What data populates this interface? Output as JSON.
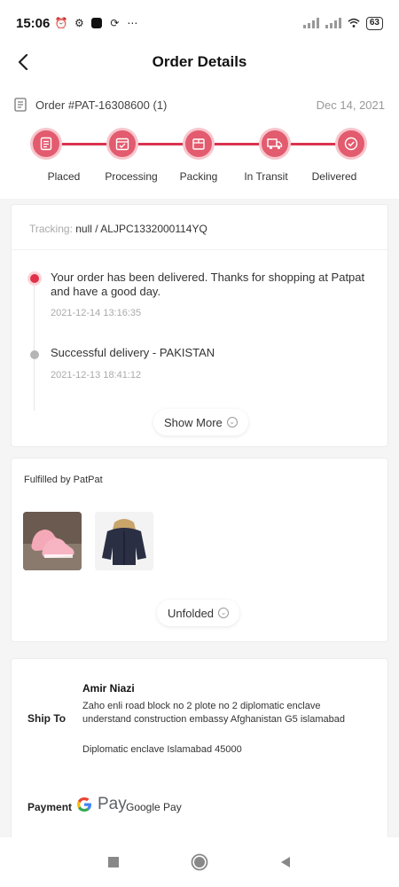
{
  "status_bar": {
    "time": "15:06",
    "battery": "63"
  },
  "header": {
    "title": "Order Details"
  },
  "order": {
    "id": "Order #PAT-16308600 (1)",
    "date": "Dec 14, 2021"
  },
  "steps": [
    {
      "label": "Placed",
      "icon": "receipt-icon"
    },
    {
      "label": "Processing",
      "icon": "calendar-check-icon"
    },
    {
      "label": "Packing",
      "icon": "package-icon"
    },
    {
      "label": "In Transit",
      "icon": "truck-icon"
    },
    {
      "label": "Delivered",
      "icon": "check-circle-icon"
    }
  ],
  "tracking": {
    "label": "Tracking:",
    "value": "null / ALJPC1332000114YQ",
    "events": [
      {
        "text": "Your order has been delivered. Thanks for shopping at Patpat and have a good day.",
        "time": "2021-12-14 13:16:35"
      },
      {
        "text": "Successful delivery - PAKISTAN",
        "time": "2021-12-13 18:41:12"
      }
    ],
    "show_more": "Show More"
  },
  "fulfilled": {
    "title": "Fulfilled by PatPat",
    "unfold": "Unfolded"
  },
  "shipping": {
    "label": "Ship To",
    "name": "Amir Niazi",
    "address": "Zaho enli road block no 2 plote no 2 diplomatic enclave understand construction embassy Afghanistan G5 islamabad",
    "city": "Diplomatic enclave Islamabad 45000"
  },
  "payment": {
    "label": "Payment",
    "brand": "Pay",
    "method": "Google Pay"
  },
  "colors": {
    "accent": "#d9344f",
    "step_fill": "#e35b6e"
  }
}
